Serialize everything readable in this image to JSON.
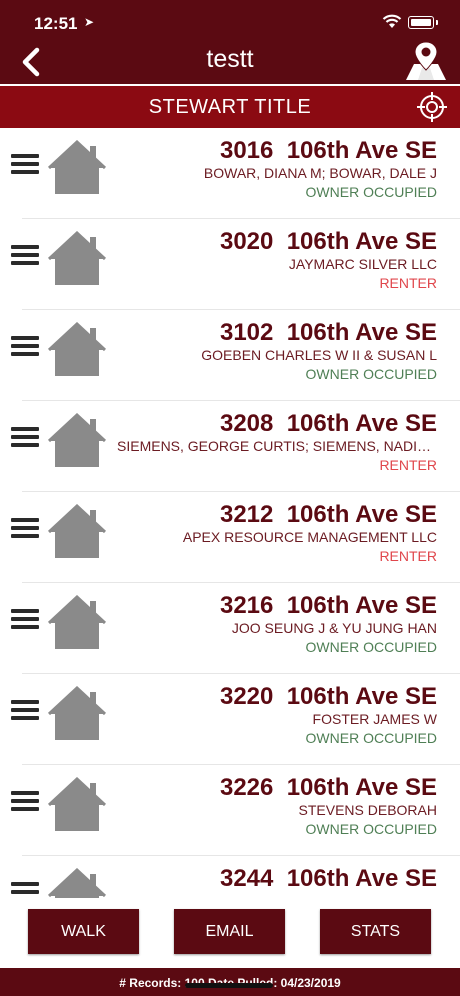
{
  "status_bar": {
    "time": "12:51",
    "location_arrow": "➤"
  },
  "nav": {
    "title": "testt"
  },
  "subheader": {
    "label": "STEWART TITLE"
  },
  "colors": {
    "brand": "#5b0a12",
    "band": "#8b0a12",
    "owner_occupied": "#4f7f55",
    "renter": "#e0474c"
  },
  "properties": [
    {
      "number": "3016",
      "street": "106th Ave SE",
      "owner": "BOWAR, DIANA M; BOWAR, DALE J",
      "occupancy": "OWNER OCCUPIED",
      "status": "owner"
    },
    {
      "number": "3020",
      "street": "106th Ave SE",
      "owner": "JAYMARC SILVER LLC",
      "occupancy": "RENTER",
      "status": "renter"
    },
    {
      "number": "3102",
      "street": "106th Ave SE",
      "owner": "GOEBEN CHARLES W II & SUSAN L",
      "occupancy": "OWNER OCCUPIED",
      "status": "owner"
    },
    {
      "number": "3208",
      "street": "106th Ave SE",
      "owner": "SIEMENS, GEORGE CURTIS; SIEMENS, NADINE…",
      "occupancy": "RENTER",
      "status": "renter"
    },
    {
      "number": "3212",
      "street": "106th Ave SE",
      "owner": "APEX RESOURCE MANAGEMENT LLC",
      "occupancy": "RENTER",
      "status": "renter"
    },
    {
      "number": "3216",
      "street": "106th Ave SE",
      "owner": "JOO SEUNG J & YU JUNG HAN",
      "occupancy": "OWNER OCCUPIED",
      "status": "owner"
    },
    {
      "number": "3220",
      "street": "106th Ave SE",
      "owner": "FOSTER JAMES W",
      "occupancy": "OWNER OCCUPIED",
      "status": "owner"
    },
    {
      "number": "3226",
      "street": "106th Ave SE",
      "owner": "STEVENS DEBORAH",
      "occupancy": "OWNER OCCUPIED",
      "status": "owner"
    },
    {
      "number": "3244",
      "street": "106th Ave SE",
      "owner": "",
      "occupancy": "",
      "status": "owner"
    }
  ],
  "buttons": {
    "walk": "WALK",
    "email": "EMAIL",
    "stats": "STATS"
  },
  "footer": {
    "text": "# Records: 100 Date Pulled: 04/23/2019"
  },
  "icons": {
    "back": "back-chevron-icon",
    "map": "map-pin-icon",
    "target": "crosshair-icon",
    "menu": "hamburger-icon",
    "house": "house-icon"
  }
}
